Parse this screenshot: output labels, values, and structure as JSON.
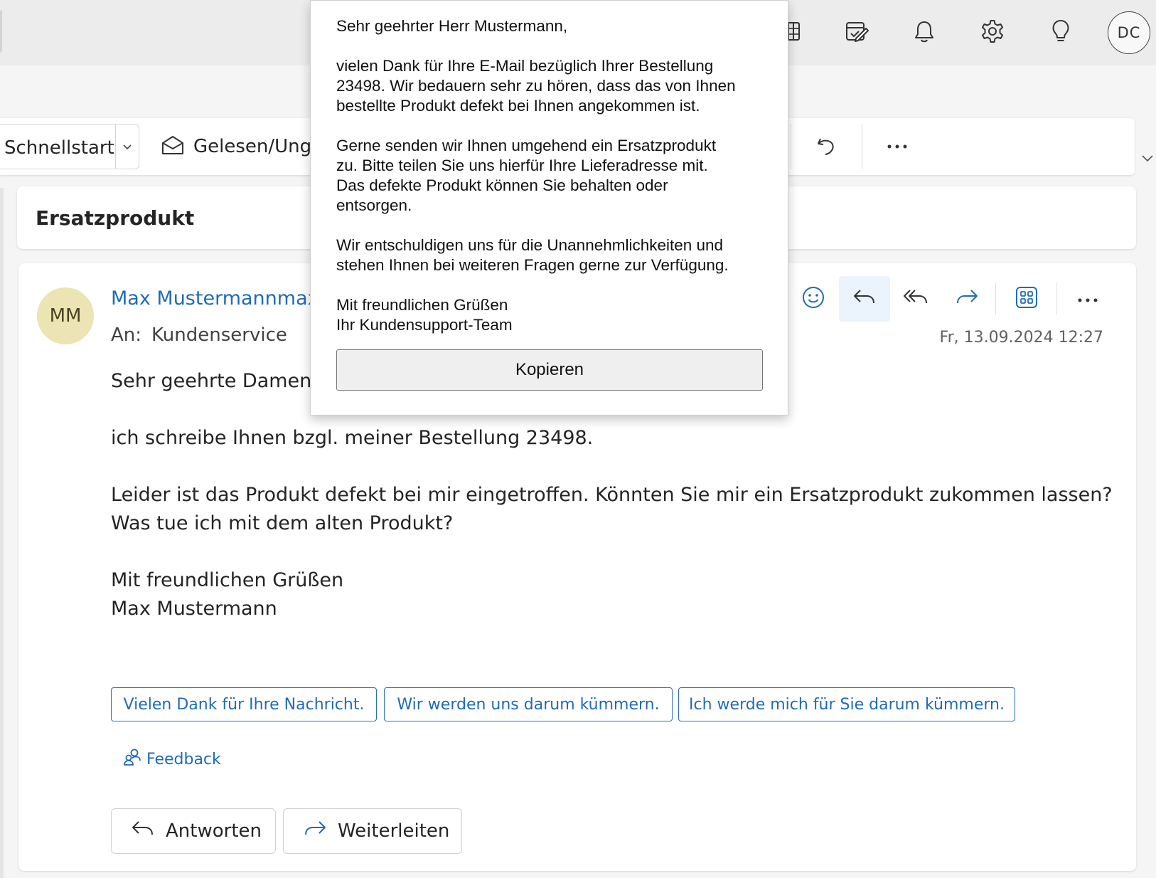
{
  "topbar": {
    "icons": [
      "calendar-week-icon",
      "task-edit-icon",
      "bell-icon",
      "gear-icon",
      "lightbulb-icon"
    ],
    "avatar_initials": "DC"
  },
  "ribbon": {
    "quickstart_label": "Schnellstart",
    "read_unread_label": "Gelesen/Ung",
    "undo_icon": "undo-icon",
    "more_icon": "more-icon"
  },
  "message": {
    "subject": "Ersatzprodukt",
    "sender_initials": "MM",
    "sender_name": "Max Mustermannmax",
    "to_label": "An:",
    "recipient": "Kundenservice",
    "date": "Fr, 13.09.2024 12:27",
    "body_lines": [
      "Sehr geehrte Damen",
      "ich schreibe Ihnen bzgl. meiner Bestellung 23498.",
      "Leider ist das Produkt defekt bei mir eingetroffen. Könnten Sie mir ein Ersatzprodukt zukommen lassen?",
      "Was tue ich mit dem alten Produkt?",
      "Mit freundlichen Grüßen",
      "Max Mustermann"
    ],
    "suggested_replies": [
      "Vielen Dank für Ihre Nachricht.",
      "Wir werden uns darum kümmern.",
      "Ich werde mich für Sie darum kümmern."
    ],
    "feedback_label": "Feedback",
    "reply_label": "Antworten",
    "forward_label": "Weiterleiten"
  },
  "popup": {
    "lines": [
      "Sehr geehrter Herr Mustermann,",
      "vielen Dank für Ihre E-Mail bezüglich Ihrer Bestellung",
      "23498. Wir bedauern sehr zu hören, dass das von Ihnen",
      "bestellte Produkt defekt bei Ihnen angekommen ist.",
      "Gerne senden wir Ihnen umgehend ein Ersatzprodukt",
      "zu. Bitte teilen Sie uns hierfür Ihre Lieferadresse mit.",
      "Das defekte Produkt können Sie behalten oder",
      "entsorgen.",
      "Wir entschuldigen uns für die Unannehmlichkeiten und",
      "stehen Ihnen bei weiteren Fragen gerne zur Verfügung.",
      "Mit freundlichen Grüßen",
      "Ihr Kundensupport-Team"
    ],
    "copy_label": "Kopieren"
  },
  "colors": {
    "accent": "#1f6bb8",
    "sender_avatar_bg": "#ece4b3",
    "selected_action_bg": "#ebf3fc"
  }
}
